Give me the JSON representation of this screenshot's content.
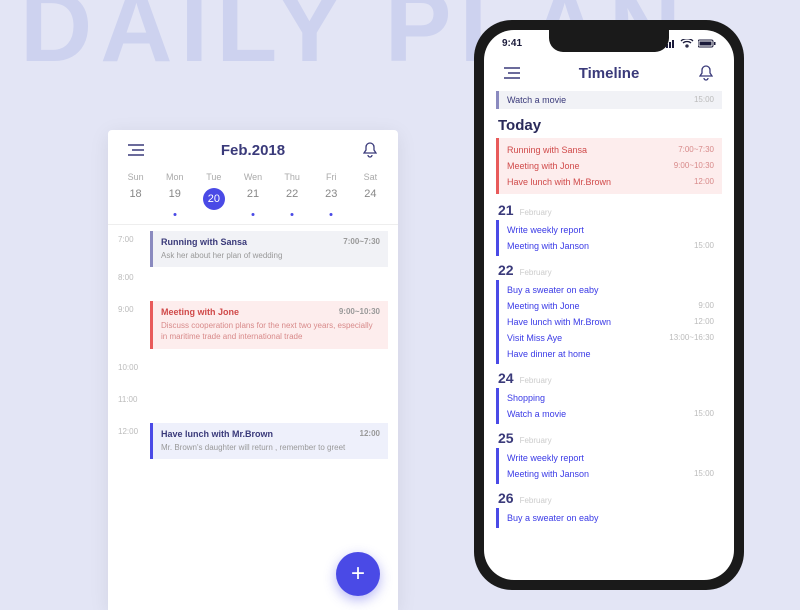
{
  "bg_text": "DAILY PLAN",
  "left": {
    "title": "Feb.2018",
    "weekdays": [
      "Sun",
      "Mon",
      "Tue",
      "Wen",
      "Thu",
      "Fri",
      "Sat"
    ],
    "dates": [
      "18",
      "19",
      "20",
      "21",
      "22",
      "23",
      "24"
    ],
    "selected_index": 2,
    "hours": [
      "7:00",
      "8:00",
      "9:00",
      "10:00",
      "11:00",
      "12:00"
    ],
    "events": [
      {
        "title": "Running with Sansa",
        "time": "7:00~7:30",
        "desc": "Ask her about her plan of wedding",
        "type": "gray",
        "slot": 0
      },
      {
        "title": "Meeting with Jone",
        "time": "9:00~10:30",
        "desc": "Discuss cooperation plans for the next two years, especially in maritime trade and international trade",
        "type": "red",
        "slot": 2
      },
      {
        "title": "Have lunch with Mr.Brown",
        "time": "12:00",
        "desc": "Mr. Brown's daughter will return , remember to greet",
        "type": "blue",
        "slot": 5
      }
    ]
  },
  "right": {
    "status_time": "9:41",
    "title": "Timeline",
    "top_item": {
      "title": "Watch a movie",
      "time": "15:00"
    },
    "today_label": "Today",
    "today_items": [
      {
        "title": "Running with Sansa",
        "time": "7:00~7:30"
      },
      {
        "title": "Meeting with Jone",
        "time": "9:00~10:30"
      },
      {
        "title": "Have lunch with Mr.Brown",
        "time": "12:00"
      }
    ],
    "days": [
      {
        "num": "21",
        "month": "February",
        "items": [
          {
            "title": "Write weekly report",
            "time": ""
          },
          {
            "title": "Meeting with Janson",
            "time": "15:00"
          }
        ]
      },
      {
        "num": "22",
        "month": "February",
        "items": [
          {
            "title": "Buy a sweater on eaby",
            "time": ""
          },
          {
            "title": "Meeting with Jone",
            "time": "9:00"
          },
          {
            "title": "Have lunch with Mr.Brown",
            "time": "12:00"
          },
          {
            "title": "Visit Miss Aye",
            "time": "13:00~16:30"
          },
          {
            "title": "Have dinner at home",
            "time": ""
          }
        ]
      },
      {
        "num": "24",
        "month": "February",
        "items": [
          {
            "title": "Shopping",
            "time": ""
          },
          {
            "title": "Watch a movie",
            "time": "15:00"
          }
        ]
      },
      {
        "num": "25",
        "month": "February",
        "items": [
          {
            "title": "Write weekly report",
            "time": ""
          },
          {
            "title": "Meeting with Janson",
            "time": "15:00"
          }
        ]
      },
      {
        "num": "26",
        "month": "February",
        "items": [
          {
            "title": "Buy a sweater on eaby",
            "time": ""
          }
        ]
      }
    ]
  }
}
